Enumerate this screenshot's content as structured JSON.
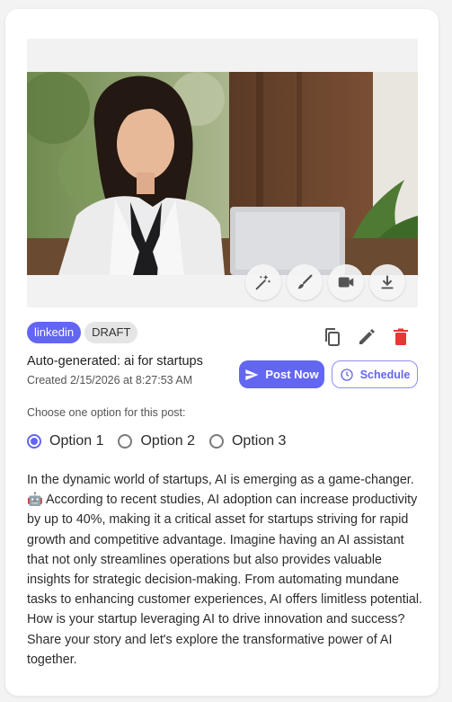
{
  "post": {
    "platform": "linkedin",
    "status": "DRAFT",
    "title": "Auto-generated: ai for startups",
    "created": "Created 2/15/2026 at 8:27:53 AM",
    "post_now_label": "Post Now",
    "schedule_label": "Schedule",
    "choose_label": "Choose one option for this post:",
    "options": [
      {
        "label": "Option 1",
        "selected": true
      },
      {
        "label": "Option 2",
        "selected": false
      },
      {
        "label": "Option 3",
        "selected": false
      }
    ],
    "body": "In the dynamic world of startups, AI is emerging as a game-changer. 🤖 According to recent studies, AI adoption can increase productivity by up to 40%, making it a critical asset for startups striving for rapid growth and competitive advantage. Imagine having an AI assistant that not only streamlines operations but also provides valuable insights for strategic decision-making. From automating mundane tasks to enhancing customer experiences, AI offers limitless potential. How is your startup leveraging AI to drive innovation and success? Share your story and let's explore the transformative power of AI together."
  },
  "media_tools": [
    "magic-wand-icon",
    "brush-icon",
    "video-icon",
    "download-icon"
  ],
  "top_actions": [
    "copy-icon",
    "edit-icon",
    "delete-icon"
  ],
  "colors": {
    "accent": "#6366f1",
    "danger": "#e53935",
    "status_bg": "#e5e5e6"
  }
}
